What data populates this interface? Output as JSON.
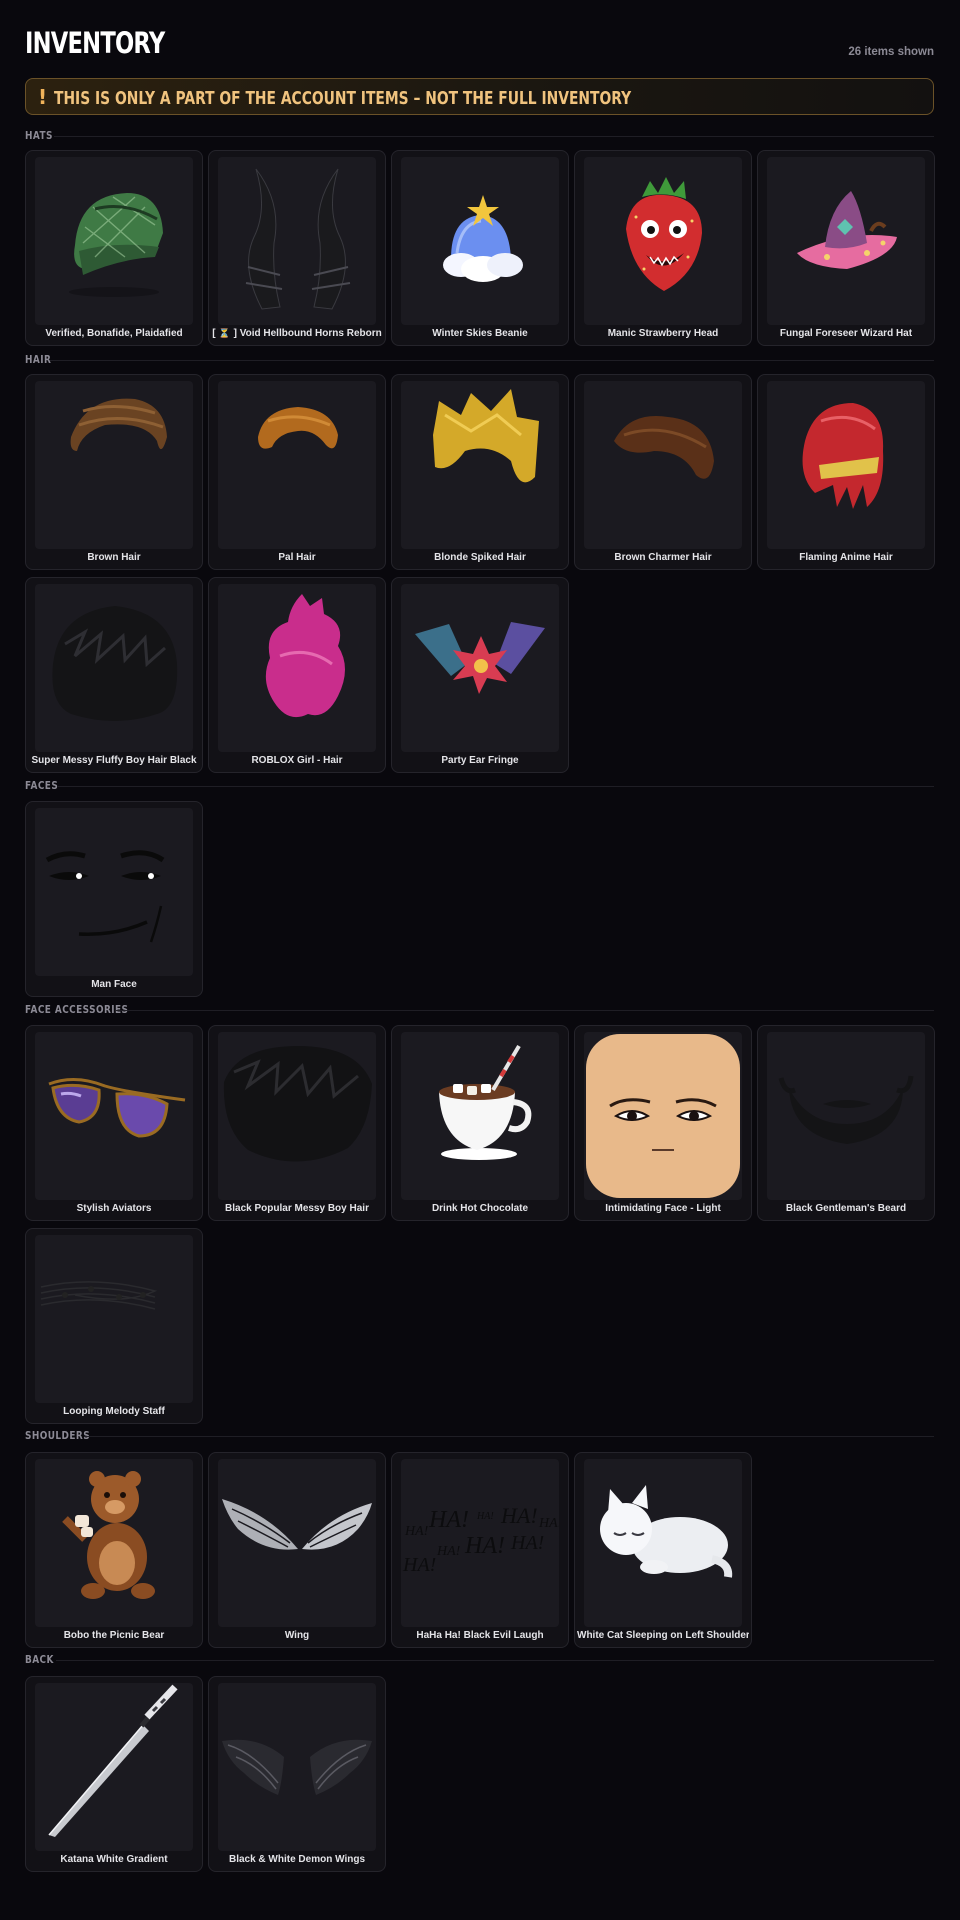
{
  "header": {
    "title": "INVENTORY",
    "count": "26 items shown"
  },
  "banner": {
    "icon": "!",
    "text": "THIS IS ONLY A PART OF THE ACCOUNT ITEMS – NOT THE FULL INVENTORY"
  },
  "sections": {
    "hats": {
      "label": "HATS",
      "items": [
        {
          "name": "Verified, Bonafide, Plaidafied",
          "icon": "plaid-cap-icon"
        },
        {
          "name": "[ ⏳ ] Void Hellbound Horns Reborn",
          "icon": "horns-icon"
        },
        {
          "name": "Winter Skies Beanie",
          "icon": "beanie-icon"
        },
        {
          "name": "Manic Strawberry Head",
          "icon": "strawberry-icon"
        },
        {
          "name": "Fungal Foreseer Wizard Hat",
          "icon": "wizard-hat-icon"
        }
      ]
    },
    "hair": {
      "label": "HAIR",
      "items": [
        {
          "name": "Brown Hair",
          "icon": "brown-hair-icon"
        },
        {
          "name": "Pal Hair",
          "icon": "pal-hair-icon"
        },
        {
          "name": "Blonde Spiked Hair",
          "icon": "blonde-hair-icon"
        },
        {
          "name": "Brown Charmer Hair",
          "icon": "charmer-hair-icon"
        },
        {
          "name": "Flaming Anime Hair",
          "icon": "flaming-hair-icon"
        },
        {
          "name": "Super Messy Fluffy Boy Hair Black",
          "icon": "messy-hair-icon"
        },
        {
          "name": "ROBLOX Girl - Hair",
          "icon": "girl-hair-icon"
        },
        {
          "name": "Party Ear Fringe",
          "icon": "ear-fringe-icon"
        }
      ]
    },
    "faces": {
      "label": "FACES",
      "items": [
        {
          "name": "Man Face",
          "icon": "man-face-icon"
        }
      ]
    },
    "face_accessories": {
      "label": "FACE ACCESSORIES",
      "items": [
        {
          "name": "Stylish Aviators",
          "icon": "aviators-icon"
        },
        {
          "name": "Black Popular Messy Boy Hair",
          "icon": "black-messy-hair-icon"
        },
        {
          "name": "Drink Hot Chocolate",
          "icon": "hot-chocolate-icon"
        },
        {
          "name": "Intimidating Face - Light",
          "icon": "intimidating-face-icon"
        },
        {
          "name": "Black Gentleman's Beard",
          "icon": "beard-icon"
        },
        {
          "name": "Looping Melody Staff",
          "icon": "melody-staff-icon"
        }
      ]
    },
    "shoulders": {
      "label": "SHOULDERS",
      "items": [
        {
          "name": "Bobo the Picnic Bear",
          "icon": "bear-icon"
        },
        {
          "name": "Wing",
          "icon": "wing-icon"
        },
        {
          "name": "HaHa Ha! Black Evil Laugh",
          "icon": "laugh-text-icon"
        },
        {
          "name": "White Cat Sleeping on Left Shoulder",
          "icon": "sleeping-cat-icon"
        }
      ]
    },
    "back": {
      "label": "BACK",
      "items": [
        {
          "name": "Katana White Gradient",
          "icon": "katana-icon"
        },
        {
          "name": "Black & White Demon Wings",
          "icon": "demon-wings-icon"
        }
      ]
    }
  },
  "laugh_words": [
    "HA!",
    "HA!",
    "HA!",
    "HA!",
    "HA!",
    "HA!",
    "HA!",
    "HA!",
    "HA!"
  ],
  "colors": {
    "background": "#09080d",
    "card": "#121116",
    "thumb": "#1b1a20",
    "banner_text": "#f0c37e",
    "banner_border": "#6b5228"
  }
}
